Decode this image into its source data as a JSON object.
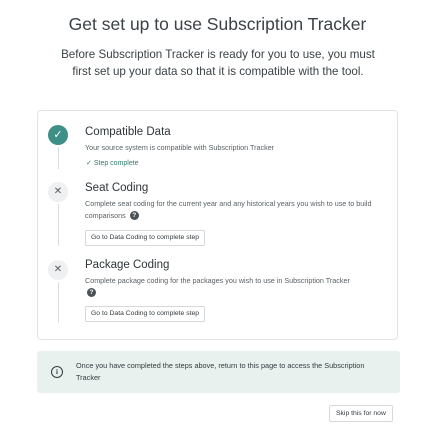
{
  "header": {
    "title": "Get set up to use Subscription Tracker",
    "subtitle": "Before Subscription Tracker is ready for you to use, you must first set up your data so that it is compatible with the tool."
  },
  "steps": [
    {
      "title": "Compatible Data",
      "description": "Your source system is compatible with Subscription Tracker",
      "status": "complete",
      "complete_label": "Step complete",
      "icon": "check-icon"
    },
    {
      "title": "Seat Coding",
      "description": "Complete seat coding for the current year and any historical years you wish to use to build comparisons",
      "status": "incomplete",
      "button_label": "Go to Data Coding to complete step",
      "icon": "x-icon"
    },
    {
      "title": "Package Coding",
      "description": "Complete package coding for the packages you wish to use in Subscription Tracker",
      "status": "incomplete",
      "button_label": "Go to Data Coding to complete step",
      "icon": "x-icon"
    }
  ],
  "info": {
    "text": "Once you have completed the steps above, return to this page to access the Subscription Tracker",
    "icon": "info-icon"
  },
  "footer": {
    "skip_label": "Skip this for now"
  },
  "colors": {
    "accent": "#3e8f86",
    "info_background": "#e8f1ee",
    "complete_text": "#2f7d70"
  }
}
